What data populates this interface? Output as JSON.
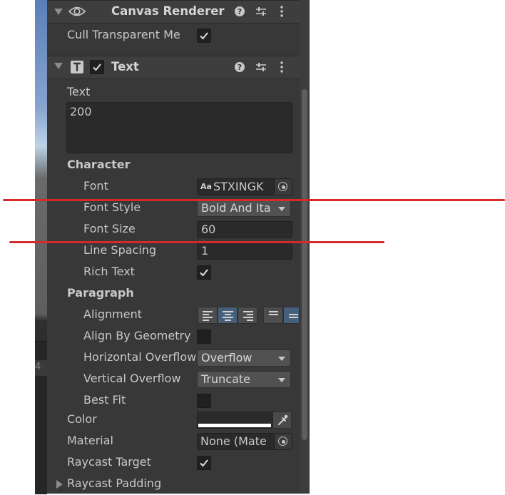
{
  "canvas_renderer": {
    "title": "Canvas Renderer",
    "cull_label": "Cull Transparent Me",
    "cull_checked": true
  },
  "text_component": {
    "title": "Text",
    "enabled": true,
    "text_label": "Text",
    "text_value": "200"
  },
  "character": {
    "header": "Character",
    "font_label": "Font",
    "font_value": "STXINGK",
    "font_style_label": "Font Style",
    "font_style_value": "Bold And Ita",
    "font_size_label": "Font Size",
    "font_size_value": "60",
    "line_spacing_label": "Line Spacing",
    "line_spacing_value": "1",
    "rich_text_label": "Rich Text",
    "rich_text_checked": true
  },
  "paragraph": {
    "header": "Paragraph",
    "alignment_label": "Alignment",
    "align_by_geometry_label": "Align By Geometry",
    "align_by_geometry_checked": false,
    "horizontal_overflow_label": "Horizontal Overflow",
    "horizontal_overflow_value": "Overflow",
    "vertical_overflow_label": "Vertical Overflow",
    "vertical_overflow_value": "Truncate",
    "best_fit_label": "Best Fit",
    "best_fit_checked": false
  },
  "color_label": "Color",
  "material_label": "Material",
  "material_value": "None (Mate",
  "raycast_target_label": "Raycast Target",
  "raycast_target_checked": true,
  "raycast_padding_label": "Raycast Padding",
  "scene_side_text": "4",
  "colors": {
    "panel_bg": "#383838",
    "annotation_red": "#d52a2a",
    "active_align": "#46607c"
  }
}
